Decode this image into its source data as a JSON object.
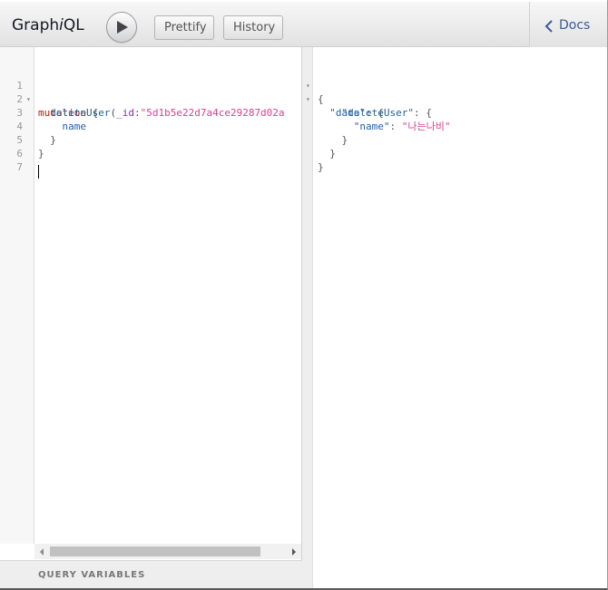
{
  "app": {
    "title_prefix": "Graph",
    "title_italic": "i",
    "title_suffix": "QL"
  },
  "toolbar": {
    "run_icon": "play-icon",
    "prettify_label": "Prettify",
    "history_label": "History",
    "docs_label": "Docs",
    "docs_icon": "chevron-left-icon"
  },
  "editor": {
    "line_numbers": [
      "1",
      "2",
      "3",
      "4",
      "5",
      "6",
      "7"
    ],
    "line1": {
      "keyword": "mutation",
      "brace": " {"
    },
    "line2": {
      "field": "deleteUser",
      "open": "(",
      "arg": "_id",
      "colon": ":",
      "value": "\"5d1b5e22d7a4ce29287d02a"
    },
    "line3": {
      "field": "name"
    },
    "line4": {
      "brace": "}"
    },
    "line5": {
      "brace": "}"
    }
  },
  "query_variables": {
    "label": "QUERY VARIABLES"
  },
  "result": {
    "line1": "{",
    "line2": {
      "key": "\"data\"",
      "rest": ": {"
    },
    "line3": {
      "key": "\"deleteUser\"",
      "rest": ": {"
    },
    "line4": {
      "key": "\"name\"",
      "sep": ": ",
      "value": "\"나는나비\""
    },
    "line5": "}",
    "line6": "}",
    "line7": "}"
  },
  "colors": {
    "keyword": "#b11a04",
    "field": "#1f61a0",
    "argument": "#8b2bb9",
    "string": "#d64292",
    "docs_link": "#3b5998"
  }
}
